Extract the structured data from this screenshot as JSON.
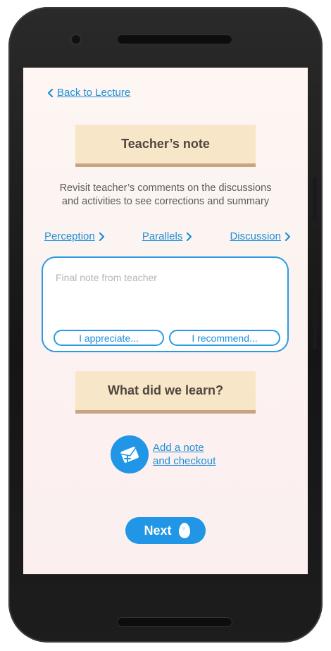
{
  "nav": {
    "back_label": "Back to Lecture"
  },
  "header": {
    "title": "Teacher’s note"
  },
  "description": {
    "line1": "Revisit teacher’s comments on the discussions",
    "line2": "and activities to see corrections and summary"
  },
  "tabs": [
    {
      "label": "Perception"
    },
    {
      "label": "Parallels"
    },
    {
      "label": "Discussion"
    }
  ],
  "note": {
    "placeholder": "Final note from teacher",
    "chips": [
      {
        "label": "I appreciate..."
      },
      {
        "label": "I recommend..."
      }
    ]
  },
  "learn": {
    "title": "What did we learn?"
  },
  "add_note": {
    "line1": "Add a note",
    "line2": "and checkout",
    "icon": "note-plus-icon"
  },
  "next": {
    "label": "Next",
    "icon": "egg-icon"
  },
  "colors": {
    "accent": "#2196e6",
    "link": "#1f8fd6",
    "banner": "#f8e6c8",
    "banner_border": "#c8a482"
  }
}
